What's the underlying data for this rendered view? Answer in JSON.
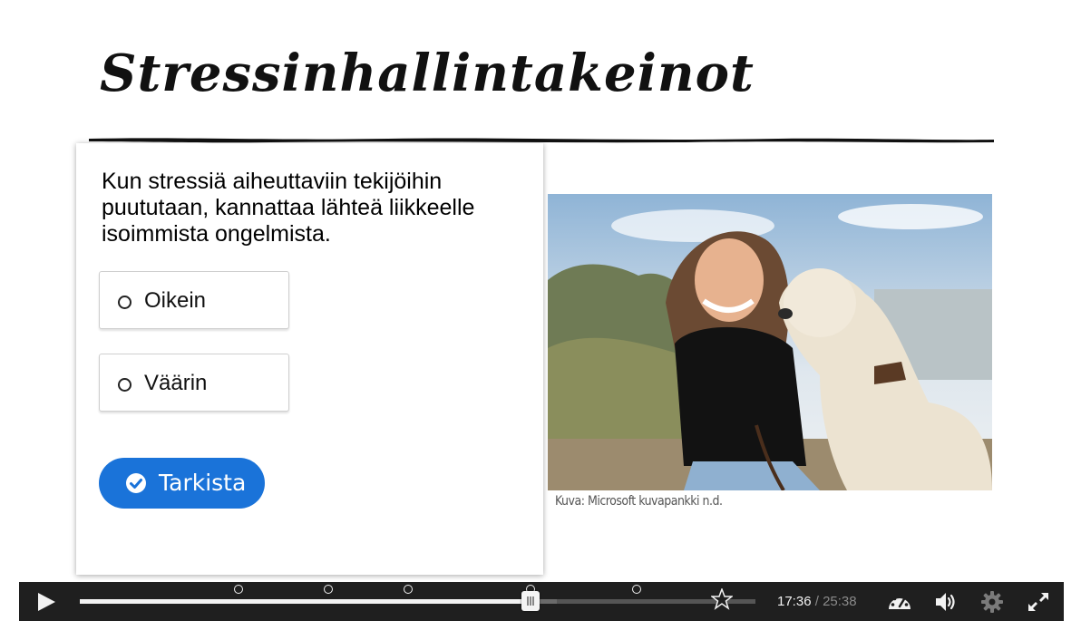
{
  "slide": {
    "title": "Stressinhallintakeinot",
    "image_caption": "Kuva: Microsoft kuvapankki n.d."
  },
  "quiz": {
    "question": "Kun stressiä aiheuttaviin tekijöihin puututaan, kannattaa lähteä liikkeelle isoimmista ongelmista.",
    "options": [
      {
        "label": "Oikein"
      },
      {
        "label": "Väärin"
      }
    ],
    "check_label": "Tarkista",
    "accent_color": "#1a73d9"
  },
  "player": {
    "current_time": "17:36",
    "separator": "/",
    "total_time": "25:38",
    "played_fraction": 0.667,
    "buffered_fraction": 0.706,
    "interaction_marker_fractions": [
      0.235,
      0.368,
      0.486,
      0.667,
      0.824,
      0.95
    ],
    "icons": [
      "play-icon",
      "speed-icon",
      "volume-icon",
      "settings-icon",
      "fullscreen-icon"
    ]
  }
}
